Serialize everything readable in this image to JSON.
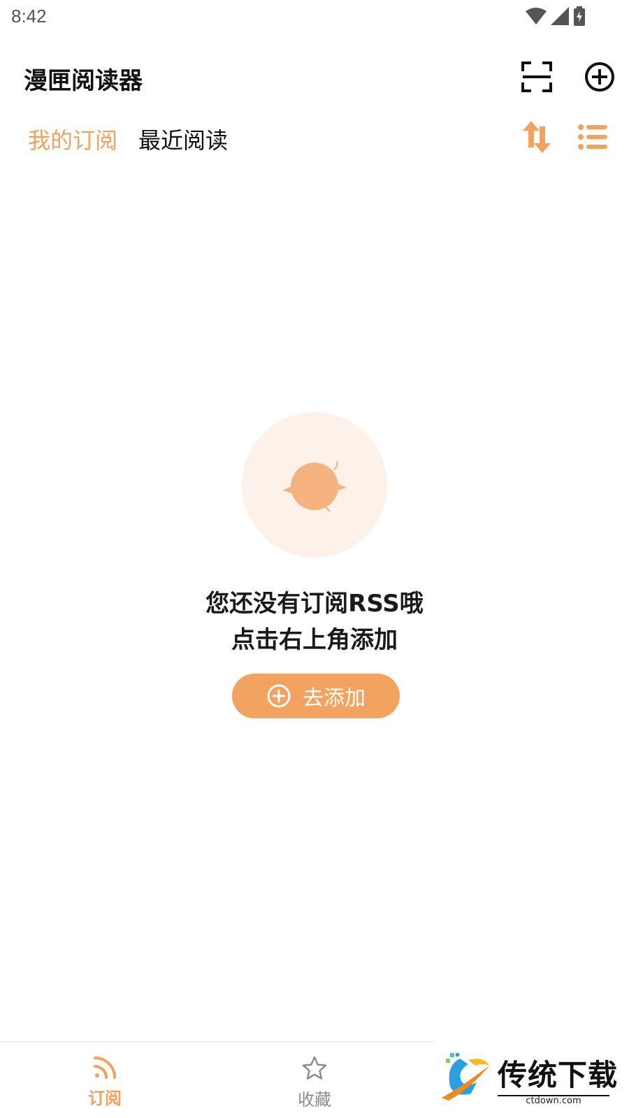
{
  "status_bar": {
    "time": "8:42"
  },
  "app_bar": {
    "title": "漫匣阅读器",
    "icons": [
      "scan-icon",
      "add-circle-icon"
    ]
  },
  "tabs": [
    {
      "label": "我的订阅",
      "active": true
    },
    {
      "label": "最近阅读",
      "active": false
    }
  ],
  "tab_actions": {
    "icons": [
      "sort-icon",
      "list-icon"
    ]
  },
  "empty_state": {
    "title": "您还没有订阅RSS哦",
    "subtitle": "点击右上角添加",
    "button_label": "去添加",
    "illustration": "bird-icon"
  },
  "bottom_nav": [
    {
      "label": "订阅",
      "icon": "rss-icon",
      "active": true
    },
    {
      "label": "收藏",
      "icon": "star-icon",
      "active": false
    }
  ],
  "watermark": {
    "text": "传统下载",
    "url": "ctdown.com"
  },
  "colors": {
    "accent": "#f0a25e",
    "button": "#f2a35f",
    "circle_bg": "#fdf2ea",
    "bird": "#f4b27e"
  }
}
